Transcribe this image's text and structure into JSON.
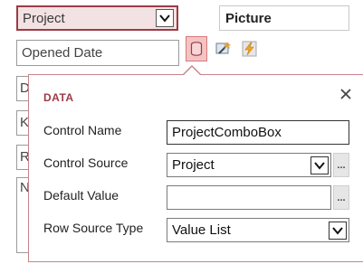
{
  "form": {
    "combo_value": "Project",
    "picture_label": "Picture",
    "opened_date_value": "Opened Date",
    "stubs": [
      "D",
      "K",
      "R",
      "N"
    ]
  },
  "toolbar_icons": [
    "database-icon",
    "wizard-icon",
    "lightning-icon"
  ],
  "popup": {
    "title": "DATA",
    "close_glyph": "✕",
    "build_glyph": "...",
    "properties": {
      "control_name": {
        "label": "Control Name",
        "value": "ProjectComboBox"
      },
      "control_source": {
        "label": "Control Source",
        "value": "Project"
      },
      "default_value": {
        "label": "Default Value",
        "value": ""
      },
      "row_source_type": {
        "label": "Row Source Type",
        "value": "Value List"
      }
    }
  },
  "colors": {
    "accent": "#9a3b46",
    "selected_fill": "#f3e2e3",
    "popup_border": "#c7838a",
    "db_icon_fill": "#f4c4c4"
  }
}
